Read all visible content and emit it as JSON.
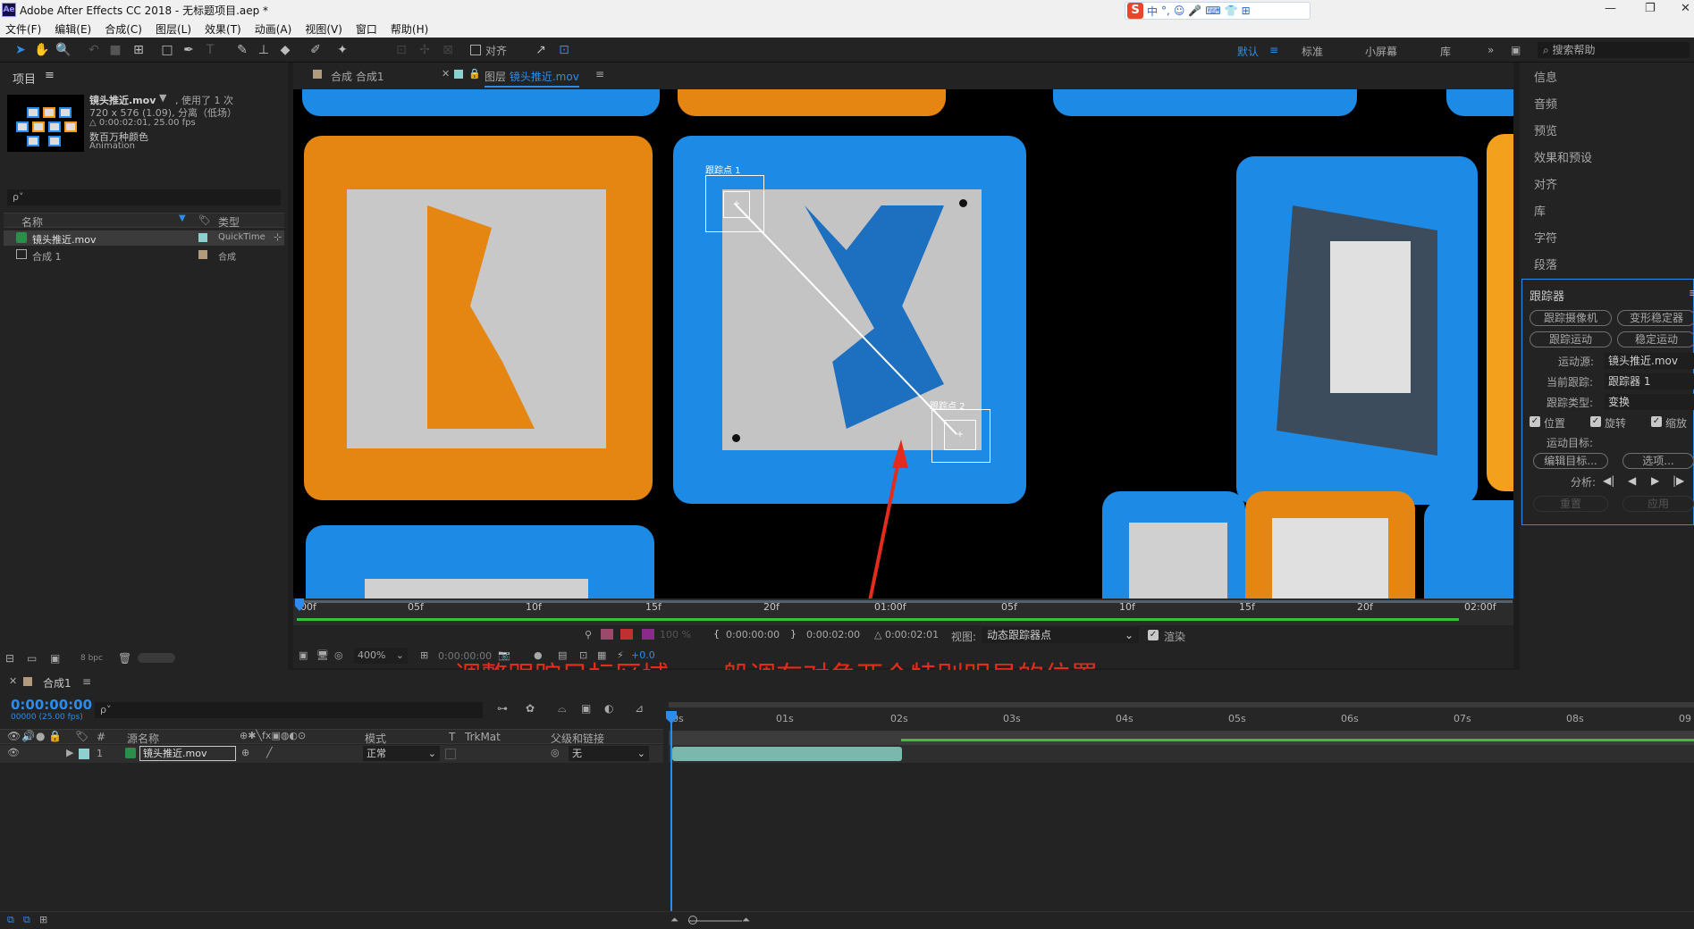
{
  "window": {
    "title": "Adobe After Effects CC 2018 - 无标题项目.aep *",
    "app_icon": "Ae"
  },
  "ime": {
    "logo": "S",
    "items": [
      "中",
      "°,",
      "☺",
      "🎤",
      "⌨",
      "👕",
      "⊞"
    ]
  },
  "menu": [
    "文件(F)",
    "编辑(E)",
    "合成(C)",
    "图层(L)",
    "效果(T)",
    "动画(A)",
    "视图(V)",
    "窗口",
    "帮助(H)"
  ],
  "toolbar": {
    "align_label": "对齐",
    "workspaces": [
      "默认",
      "标准",
      "小屏幕",
      "库"
    ],
    "search_placeholder": "搜索帮助"
  },
  "project": {
    "title": "项目",
    "selected_file": "镜头推近.mov",
    "usage": ", 使用了 1 次",
    "info1": "720 x 576 (1.09), 分离（低场）",
    "info2": "△ 0:00:02:01, 25.00 fps",
    "info3": "数百万种颜色",
    "info4": "Animation",
    "search_placeholder": "ρ˅",
    "col_name": "名称",
    "col_type": "类型",
    "items": [
      {
        "name": "镜头推近.mov",
        "type": "QuickTime",
        "color": "#8ecfd0"
      },
      {
        "name": "合成 1",
        "type": "合成",
        "color": "#b49a7c"
      }
    ],
    "bpc": "8 bpc"
  },
  "viewer": {
    "tab_comp": "合成 合成1",
    "tab_layer_prefix": "图层",
    "tab_layer": "镜头推近.mov",
    "track1": "跟踪点 1",
    "track2": "跟踪点 2",
    "ruler_ticks": [
      "00f",
      "05f",
      "10f",
      "15f",
      "20f",
      "01:00f",
      "05f",
      "10f",
      "15f",
      "20f",
      "02:00f"
    ],
    "time_in": "0:00:00:00",
    "time_out": "0:00:02:00",
    "duration": "△ 0:00:02:01",
    "view_label": "视图:",
    "view_value": "动态跟踪器点",
    "render_label": "渲染",
    "zoom": "400%",
    "zoom_pct": "100 %",
    "current_time": "0:00:00:00",
    "resolution": "+0.0"
  },
  "annotation": "调整跟踪目标区域，一般调在对角两个特别明显的位置",
  "right_panel": {
    "items": [
      "信息",
      "音频",
      "预览",
      "效果和预设",
      "对齐",
      "库",
      "字符",
      "段落"
    ],
    "tracker_title": "跟踪器",
    "btn_track_camera": "跟踪摄像机",
    "btn_warp": "变形稳定器",
    "btn_track_motion": "跟踪运动",
    "btn_stabilize": "稳定运动",
    "motion_source_label": "运动源:",
    "motion_source": "镜头推近.mov",
    "current_track_label": "当前跟踪:",
    "current_track": "跟踪器 1",
    "track_type_label": "跟踪类型:",
    "track_type": "变换",
    "chk_position": "位置",
    "chk_rotation": "旋转",
    "chk_scale": "缩放",
    "motion_target_label": "运动目标:",
    "btn_edit_target": "编辑目标...",
    "btn_options": "选项...",
    "analyze_label": "分析:",
    "btn_reset": "重置",
    "btn_apply": "应用"
  },
  "timeline": {
    "tab": "合成1",
    "timecode": "0:00:00:00",
    "frames": "00000 (25.00 fps)",
    "search_placeholder": "ρ˅",
    "col_num": "#",
    "col_source": "源名称",
    "col_mode": "模式",
    "col_t": "T",
    "col_trkmat": "TrkMat",
    "col_parent": "父级和链接",
    "layer": {
      "index": "1",
      "name": "镜头推近.mov",
      "mode": "正常",
      "parent": "无"
    },
    "ticks": [
      "0s",
      "01s",
      "02s",
      "03s",
      "04s",
      "05s",
      "06s",
      "07s",
      "08s",
      "09"
    ]
  },
  "colors": {
    "accent": "#2d8ceb",
    "annotation": "#e52b1c",
    "track": "#ffffff",
    "green": "#37c23c"
  }
}
